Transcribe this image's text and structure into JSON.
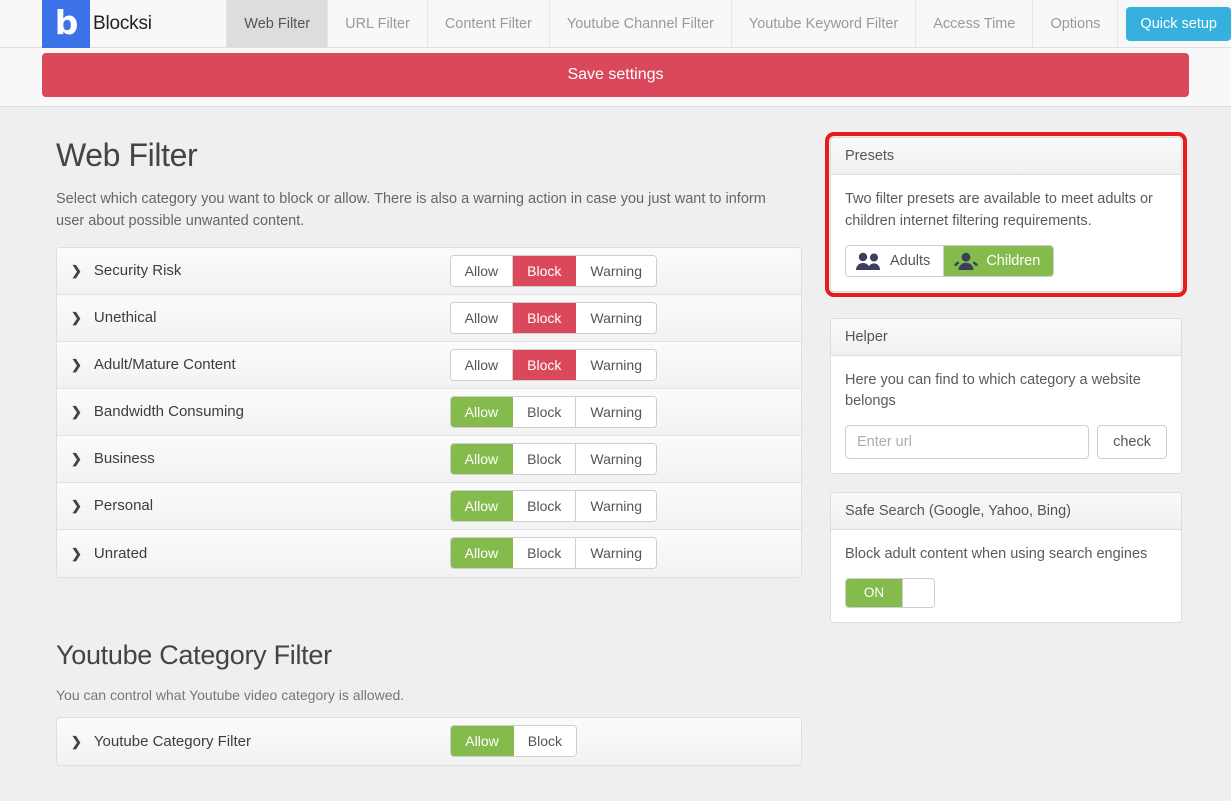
{
  "brand": {
    "name": "Blocksi",
    "logo_letter": "b",
    "logo_color": "#3b72e8"
  },
  "nav": {
    "tabs": [
      {
        "label": "Web Filter",
        "active": true
      },
      {
        "label": "URL Filter",
        "active": false
      },
      {
        "label": "Content Filter",
        "active": false
      },
      {
        "label": "Youtube Channel Filter",
        "active": false
      },
      {
        "label": "Youtube Keyword Filter",
        "active": false
      },
      {
        "label": "Access Time",
        "active": false
      },
      {
        "label": "Options",
        "active": false
      }
    ],
    "quick_setup_label": "Quick setup",
    "quick_setup_color": "#36b0de"
  },
  "save_bar": {
    "label": "Save settings",
    "color": "#d9485b"
  },
  "web_filter": {
    "title": "Web Filter",
    "description": "Select which category you want to block or allow. There is also a warning action in case you just want to inform user about possible unwanted content.",
    "actions": {
      "allow": "Allow",
      "block": "Block",
      "warning": "Warning"
    },
    "rows": [
      {
        "label": "Security Risk",
        "selected": "Block"
      },
      {
        "label": "Unethical",
        "selected": "Block"
      },
      {
        "label": "Adult/Mature Content",
        "selected": "Block"
      },
      {
        "label": "Bandwidth Consuming",
        "selected": "Allow"
      },
      {
        "label": "Business",
        "selected": "Allow"
      },
      {
        "label": "Personal",
        "selected": "Allow"
      },
      {
        "label": "Unrated",
        "selected": "Allow"
      }
    ]
  },
  "presets": {
    "header": "Presets",
    "description": "Two filter presets are available to meet adults or children internet filtering requirements.",
    "adults_label": "Adults",
    "children_label": "Children",
    "selected": "Children",
    "highlight_color": "#e81c1c"
  },
  "helper": {
    "header": "Helper",
    "description": "Here you can find to which category a website belongs",
    "input_value": "",
    "input_placeholder": "Enter url",
    "check_label": "check"
  },
  "safe_search": {
    "header": "Safe Search (Google, Yahoo, Bing)",
    "description": "Block adult content when using search engines",
    "toggle_state": "ON"
  },
  "youtube_filter": {
    "title": "Youtube Category Filter",
    "description": "You can control what Youtube video category is allowed.",
    "row_label": "Youtube Category Filter",
    "allow_label": "Allow",
    "block_label": "Block",
    "selected": "Allow"
  },
  "icons": {
    "chevron": "❯",
    "adults": "people-icon",
    "children": "child-icon"
  }
}
